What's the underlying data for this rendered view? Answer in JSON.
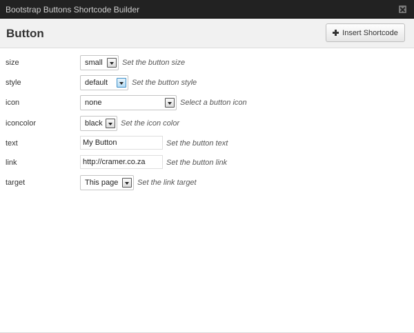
{
  "window": {
    "title": "Bootstrap Buttons Shortcode Builder"
  },
  "header": {
    "heading": "Button",
    "insert_label": "Insert Shortcode"
  },
  "fields": {
    "size": {
      "label": "size",
      "value": "small",
      "hint": "Set the button size"
    },
    "style": {
      "label": "style",
      "value": "default",
      "hint": "Set the button style"
    },
    "icon": {
      "label": "icon",
      "value": "none",
      "hint": "Select a button icon"
    },
    "iconcolor": {
      "label": "iconcolor",
      "value": "black",
      "hint": "Set the icon color"
    },
    "text": {
      "label": "text",
      "value": "My Button",
      "hint": "Set the button text"
    },
    "link": {
      "label": "link",
      "value": "http://cramer.co.za",
      "hint": "Set the button link"
    },
    "target": {
      "label": "target",
      "value": "This page",
      "hint": "Set the link target"
    }
  }
}
